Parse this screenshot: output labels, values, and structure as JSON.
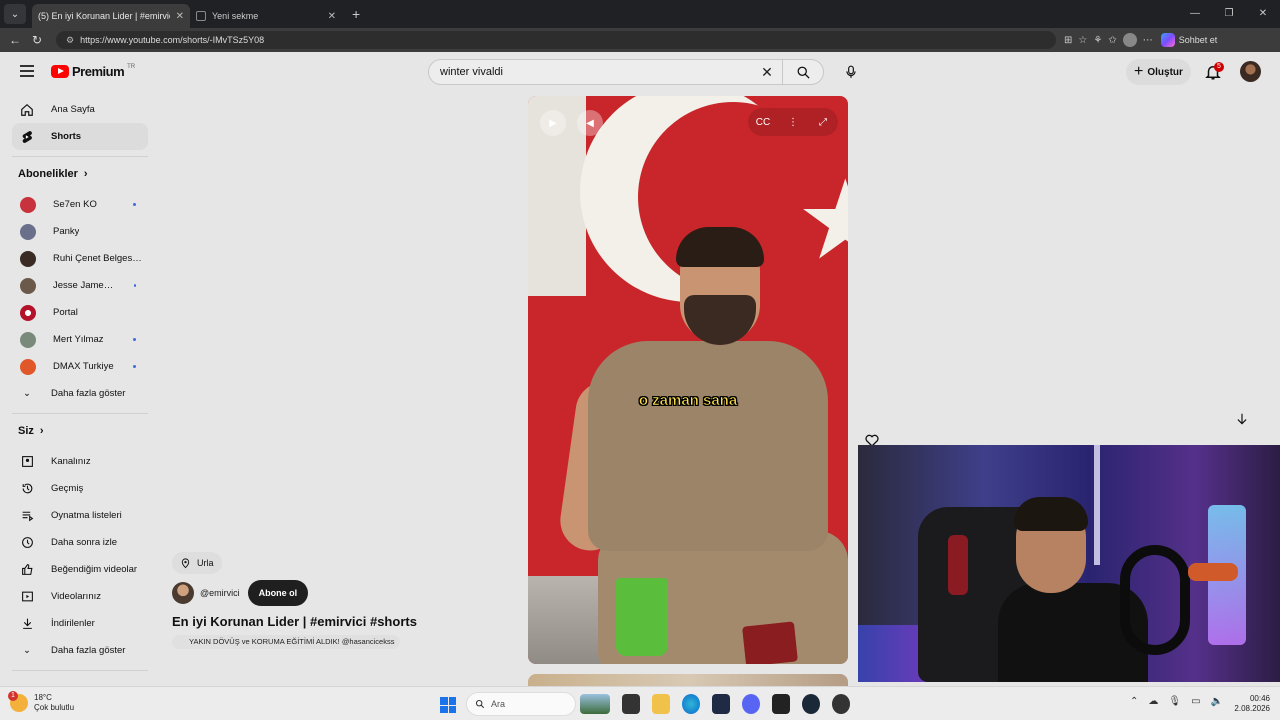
{
  "browser": {
    "tabs": [
      {
        "title": "(5) En iyi Korunan Lider | #emirvici",
        "active": true
      },
      {
        "title": "Yeni sekme",
        "active": false
      }
    ],
    "url": "https://www.youtube.com/shorts/-IMvTSz5Y08",
    "chat_label": "Sohbet et"
  },
  "header": {
    "logo": "Premium",
    "logo_region": "TR",
    "search_value": "winter vivaldi",
    "create_label": "Oluştur",
    "notification_count": "5"
  },
  "sidebar": {
    "main": [
      {
        "label": "Ana Sayfa",
        "icon": "home-icon"
      },
      {
        "label": "Shorts",
        "icon": "shorts-icon"
      }
    ],
    "subscriptions_title": "Abonelikler",
    "subscriptions": [
      {
        "label": "Se7en KO",
        "color": "#c8323c",
        "dot": true
      },
      {
        "label": "Panky",
        "color": "#6a6f8a",
        "dot": false
      },
      {
        "label": "Ruhi Çenet Belgese...",
        "color": "#3a2b24",
        "dot": false
      },
      {
        "label": "Jesse James We...",
        "color": "#6b5a4a",
        "dot": true
      },
      {
        "label": "Portal",
        "color": "#b3122a",
        "dot": false
      },
      {
        "label": "Mert Yılmaz",
        "color": "#7a8a7a",
        "dot": true
      },
      {
        "label": "DMAX Turkiye",
        "color": "#e0572a",
        "dot": true
      }
    ],
    "subs_more": "Daha fazla göster",
    "you_title": "Siz",
    "you": [
      {
        "label": "Kanalınız",
        "icon": "channel-icon"
      },
      {
        "label": "Geçmiş",
        "icon": "history-icon"
      },
      {
        "label": "Oynatma listeleri",
        "icon": "playlist-icon"
      },
      {
        "label": "Daha sonra izle",
        "icon": "clock-icon"
      },
      {
        "label": "Beğendiğim videolar",
        "icon": "thumbs-up-icon"
      },
      {
        "label": "Videolarınız",
        "icon": "video-icon"
      },
      {
        "label": "İndirilenler",
        "icon": "download-icon"
      }
    ],
    "you_more": "Daha fazla göster"
  },
  "short": {
    "caption": "o zaman sana",
    "location": "Urla",
    "channel": "@emirvici",
    "subscribe_label": "Abone ol",
    "title": "En iyi Korunan Lider | #emirvici #shorts",
    "description": "YAKIN DÖVÜŞ ve KORUMA EĞİTİMİ ALDIK! @hasancicekss"
  },
  "taskbar": {
    "temperature": "18°C",
    "weather": "Çok bulutlu",
    "weather_badge": "1",
    "search_placeholder": "Ara",
    "time": "00:46",
    "date": "2.08.2026"
  }
}
